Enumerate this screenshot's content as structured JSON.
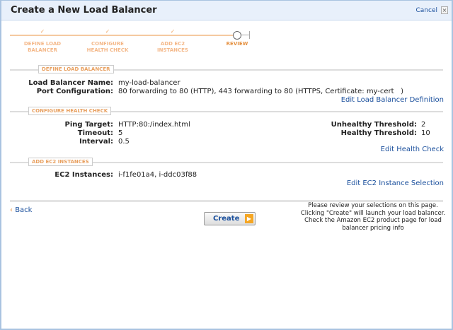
{
  "window": {
    "title": "Create a New Load Balancer",
    "cancel": "Cancel",
    "close": "×"
  },
  "steps": [
    {
      "label1": "DEFINE LOAD",
      "label2": "BALANCER",
      "done": true
    },
    {
      "label1": "CONFIGURE",
      "label2": "HEALTH CHECK",
      "done": true
    },
    {
      "label1": "ADD EC2",
      "label2": "INSTANCES",
      "done": true
    },
    {
      "label1": "REVIEW",
      "label2": "",
      "done": false
    }
  ],
  "check": "✓",
  "define": {
    "heading": "DEFINE LOAD BALANCER",
    "name_label": "Load Balancer Name:",
    "name": "my-load-balancer",
    "port_label": "Port Configuration:",
    "port": "80 forwarding to 80 (HTTP), 443 forwarding to 80 (HTTPS, Certificate: my-cert   )",
    "edit": "Edit Load Balancer Definition"
  },
  "health": {
    "heading": "CONFIGURE HEALTH CHECK",
    "ping_label": "Ping Target:",
    "ping": "HTTP:80:/index.html",
    "timeout_label": "Timeout:",
    "timeout": "5",
    "interval_label": "Interval:",
    "interval": "0.5",
    "unhealthy_label": "Unhealthy Threshold:",
    "unhealthy": "2",
    "healthy_label": "Healthy Threshold:",
    "healthy": "10",
    "edit": "Edit Health Check"
  },
  "ec2": {
    "heading": "ADD EC2 INSTANCES",
    "instances_label": "EC2 Instances:",
    "instances": "i-f1fe01a4, i-ddc03f88",
    "edit": "Edit EC2 Instance Selection"
  },
  "footer": {
    "back_arrow": "‹",
    "back": "Back",
    "create": "Create",
    "create_arrow": "▶",
    "note1": "Please review your selections on this page.",
    "note2": "Clicking \"Create\" will launch your load balancer.",
    "note3": "Check the Amazon EC2 product page for load",
    "note4": "balancer pricing info"
  }
}
